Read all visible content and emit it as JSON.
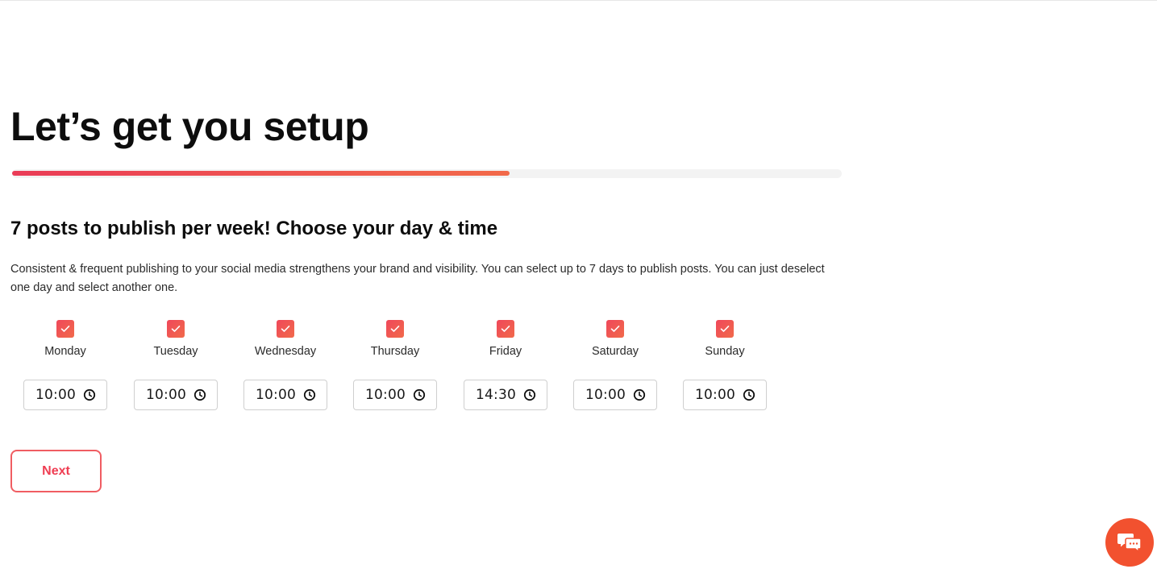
{
  "header": {
    "title": "Let’s get you setup"
  },
  "progress": {
    "fraction": 0.6
  },
  "schedule": {
    "heading": "7 posts to publish per week! Choose your day & time",
    "description": "Consistent & frequent publishing to your social media strengthens your brand and visibility. You can select up to 7 days to publish posts. You can just deselect one day and select another one.",
    "days": [
      {
        "label": "Monday",
        "checked": true,
        "time": "10:00"
      },
      {
        "label": "Tuesday",
        "checked": true,
        "time": "10:00"
      },
      {
        "label": "Wednesday",
        "checked": true,
        "time": "10:00"
      },
      {
        "label": "Thursday",
        "checked": true,
        "time": "10:00"
      },
      {
        "label": "Friday",
        "checked": true,
        "time": "14:30"
      },
      {
        "label": "Saturday",
        "checked": true,
        "time": "10:00"
      },
      {
        "label": "Sunday",
        "checked": true,
        "time": "10:00"
      }
    ]
  },
  "actions": {
    "next_label": "Next"
  },
  "icons": {
    "checkbox": "check-icon",
    "time": "clock-icon",
    "chat": "chat-icon"
  },
  "colors": {
    "accent": "#ef3d52",
    "accent_gradient_end": "#f26a4a",
    "chat_button": "#f2512f"
  }
}
